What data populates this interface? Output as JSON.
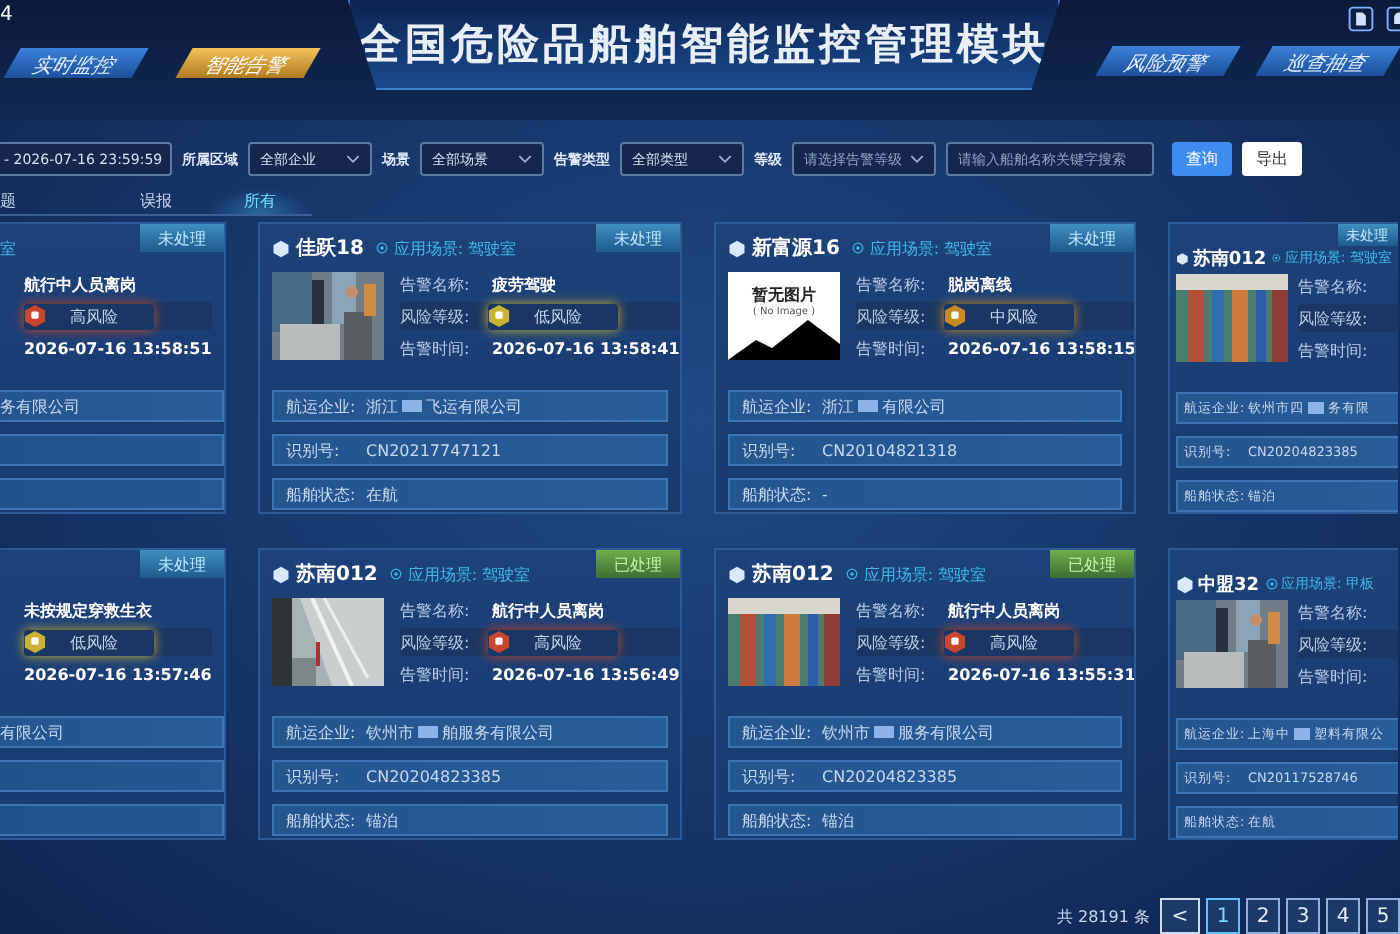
{
  "clock_fragment": "4",
  "title": "全国危险品船舶智能监控管理模块",
  "nav_left": [
    {
      "label": "实时监控",
      "selected": false
    },
    {
      "label": "智能告警",
      "selected": true
    }
  ],
  "nav_right": [
    {
      "label": "风险预警",
      "selected": false
    },
    {
      "label": "巡查抽查",
      "selected": false
    }
  ],
  "filters": {
    "date_value": "- 2026-07-16 23:59:59",
    "selects": [
      {
        "label": "所属区域",
        "value": "全部企业"
      },
      {
        "label": "场景",
        "value": "全部场景"
      },
      {
        "label": "告警类型",
        "value": "全部类型"
      }
    ],
    "level": {
      "label": "等级",
      "placeholder": "请选择告警等级"
    },
    "search": {
      "placeholder": "请输入船舶名称关键字搜索"
    },
    "buttons": [
      {
        "label": "查询",
        "kind": "primary"
      },
      {
        "label": "导出",
        "kind": "plain"
      }
    ]
  },
  "subtabs": [
    {
      "label": "题",
      "selected": false
    },
    {
      "label": "误报",
      "selected": false
    },
    {
      "label": "所有",
      "selected": true
    }
  ],
  "cards": [
    {
      "kind": "left",
      "scene": "室",
      "status": {
        "label": "未处理",
        "handled": false
      },
      "details": [
        {
          "kind": "text",
          "value": "航行中人员离岗"
        },
        {
          "kind": "risk",
          "value": "高风险",
          "color": "#c8452e"
        },
        {
          "kind": "text",
          "value": "2026-07-16 13:58:51"
        }
      ],
      "info": [
        {
          "kind": "filled",
          "parts": [
            "务有限公司"
          ]
        },
        {
          "kind": "blank"
        },
        {
          "kind": "blank"
        }
      ]
    },
    {
      "kind": "full",
      "title": "佳跃18",
      "scene": "应用场景: 驾驶室",
      "status": {
        "label": "未处理",
        "handled": false
      },
      "details": [
        {
          "kind": "text",
          "label": "告警名称:",
          "value": "疲劳驾驶"
        },
        {
          "kind": "risk",
          "label": "风险等级:",
          "value": "低风险",
          "color": "#c9b234"
        },
        {
          "kind": "text",
          "label": "告警时间:",
          "value": "2026-07-16 13:58:41"
        }
      ],
      "info": [
        {
          "label": "航运企业:",
          "parts": [
            "浙江",
            "飞运有限公司"
          ]
        },
        {
          "label": "识别号:",
          "parts": [
            "CN20217747121"
          ]
        },
        {
          "label": "船舶状态:",
          "parts": [
            "在航"
          ]
        }
      ]
    },
    {
      "kind": "full",
      "title": "新富源16",
      "scene": "应用场景: 驾驶室",
      "status": {
        "label": "未处理",
        "handled": false
      },
      "image": {
        "kind": "placeholder",
        "text": "暂无图片",
        "subtext": "( No Image )"
      },
      "details": [
        {
          "kind": "text",
          "label": "告警名称:",
          "value": "脱岗离线"
        },
        {
          "kind": "risk",
          "label": "风险等级:",
          "value": "中风险",
          "color": "#c98a26"
        },
        {
          "kind": "text",
          "label": "告警时间:",
          "value": "2026-07-16 13:58:15"
        }
      ],
      "info": [
        {
          "label": "航运企业:",
          "parts": [
            "浙江",
            "有限公司"
          ]
        },
        {
          "label": "识别号:",
          "parts": [
            "CN20104821318"
          ]
        },
        {
          "label": "船舶状态:",
          "parts": [
            "-"
          ]
        }
      ]
    },
    {
      "kind": "right",
      "title": "苏南012",
      "scene": "应用场景: 驾驶室",
      "status": {
        "label": "未处理",
        "handled": false
      },
      "details": [
        {
          "kind": "text",
          "label": "告警名称:"
        },
        {
          "kind": "risk",
          "label": "风险等级:"
        },
        {
          "kind": "text",
          "label": "告警时间:"
        }
      ],
      "info": [
        {
          "label": "航运企业:",
          "parts": [
            "钦州市四",
            "务有限"
          ]
        },
        {
          "label": "识别号:",
          "parts": [
            "CN20204823385"
          ]
        },
        {
          "label": "船舶状态:",
          "parts": [
            "锚泊"
          ]
        }
      ]
    },
    {
      "kind": "left",
      "status": {
        "label": "未处理",
        "handled": false
      },
      "details": [
        {
          "kind": "text",
          "value": "未按规定穿救生衣"
        },
        {
          "kind": "risk",
          "value": "低风险",
          "color": "#c9b234"
        },
        {
          "kind": "text",
          "value": "2026-07-16 13:57:46"
        }
      ],
      "info": [
        {
          "kind": "filled",
          "parts": [
            "有限公司"
          ]
        },
        {
          "kind": "blank"
        },
        {
          "kind": "blank"
        }
      ]
    },
    {
      "kind": "full",
      "title": "苏南012",
      "scene": "应用场景: 驾驶室",
      "status": {
        "label": "已处理",
        "handled": true
      },
      "details": [
        {
          "kind": "text",
          "label": "告警名称:",
          "value": "航行中人员离岗"
        },
        {
          "kind": "risk",
          "label": "风险等级:",
          "value": "高风险",
          "color": "#c8452e"
        },
        {
          "kind": "text",
          "label": "告警时间:",
          "value": "2026-07-16 13:56:49"
        }
      ],
      "info": [
        {
          "label": "航运企业:",
          "parts": [
            "钦州市",
            "舶服务有限公司"
          ]
        },
        {
          "label": "识别号:",
          "parts": [
            "CN20204823385"
          ]
        },
        {
          "label": "船舶状态:",
          "parts": [
            "锚泊"
          ]
        }
      ]
    },
    {
      "kind": "full",
      "title": "苏南012",
      "scene": "应用场景: 驾驶室",
      "status": {
        "label": "已处理",
        "handled": true
      },
      "details": [
        {
          "kind": "text",
          "label": "告警名称:",
          "value": "航行中人员离岗"
        },
        {
          "kind": "risk",
          "label": "风险等级:",
          "value": "高风险",
          "color": "#c8452e"
        },
        {
          "kind": "text",
          "label": "告警时间:",
          "value": "2026-07-16 13:55:31"
        }
      ],
      "info": [
        {
          "label": "航运企业:",
          "parts": [
            "钦州市",
            "服务有限公司"
          ]
        },
        {
          "label": "识别号:",
          "parts": [
            "CN20204823385"
          ]
        },
        {
          "label": "船舶状态:",
          "parts": [
            "锚泊"
          ]
        }
      ]
    },
    {
      "kind": "right",
      "title": "中盟32",
      "scene": "应用场景: 甲板",
      "details": [
        {
          "kind": "text",
          "label": "告警名称:"
        },
        {
          "kind": "risk",
          "label": "风险等级:"
        },
        {
          "kind": "text",
          "label": "告警时间:"
        }
      ],
      "info": [
        {
          "label": "航运企业:",
          "parts": [
            "上海中",
            "塑料有限公"
          ]
        },
        {
          "label": "识别号:",
          "parts": [
            "CN20117528746"
          ]
        },
        {
          "label": "船舶状态:",
          "parts": [
            "在航"
          ]
        }
      ]
    }
  ],
  "pagination": {
    "total": "共 28191 条",
    "prev": "<",
    "pages": [
      {
        "label": "1",
        "selected": true
      },
      {
        "label": "2",
        "selected": false
      },
      {
        "label": "3",
        "selected": false
      },
      {
        "label": "4",
        "selected": false
      },
      {
        "label": "5",
        "selected": false
      }
    ]
  }
}
